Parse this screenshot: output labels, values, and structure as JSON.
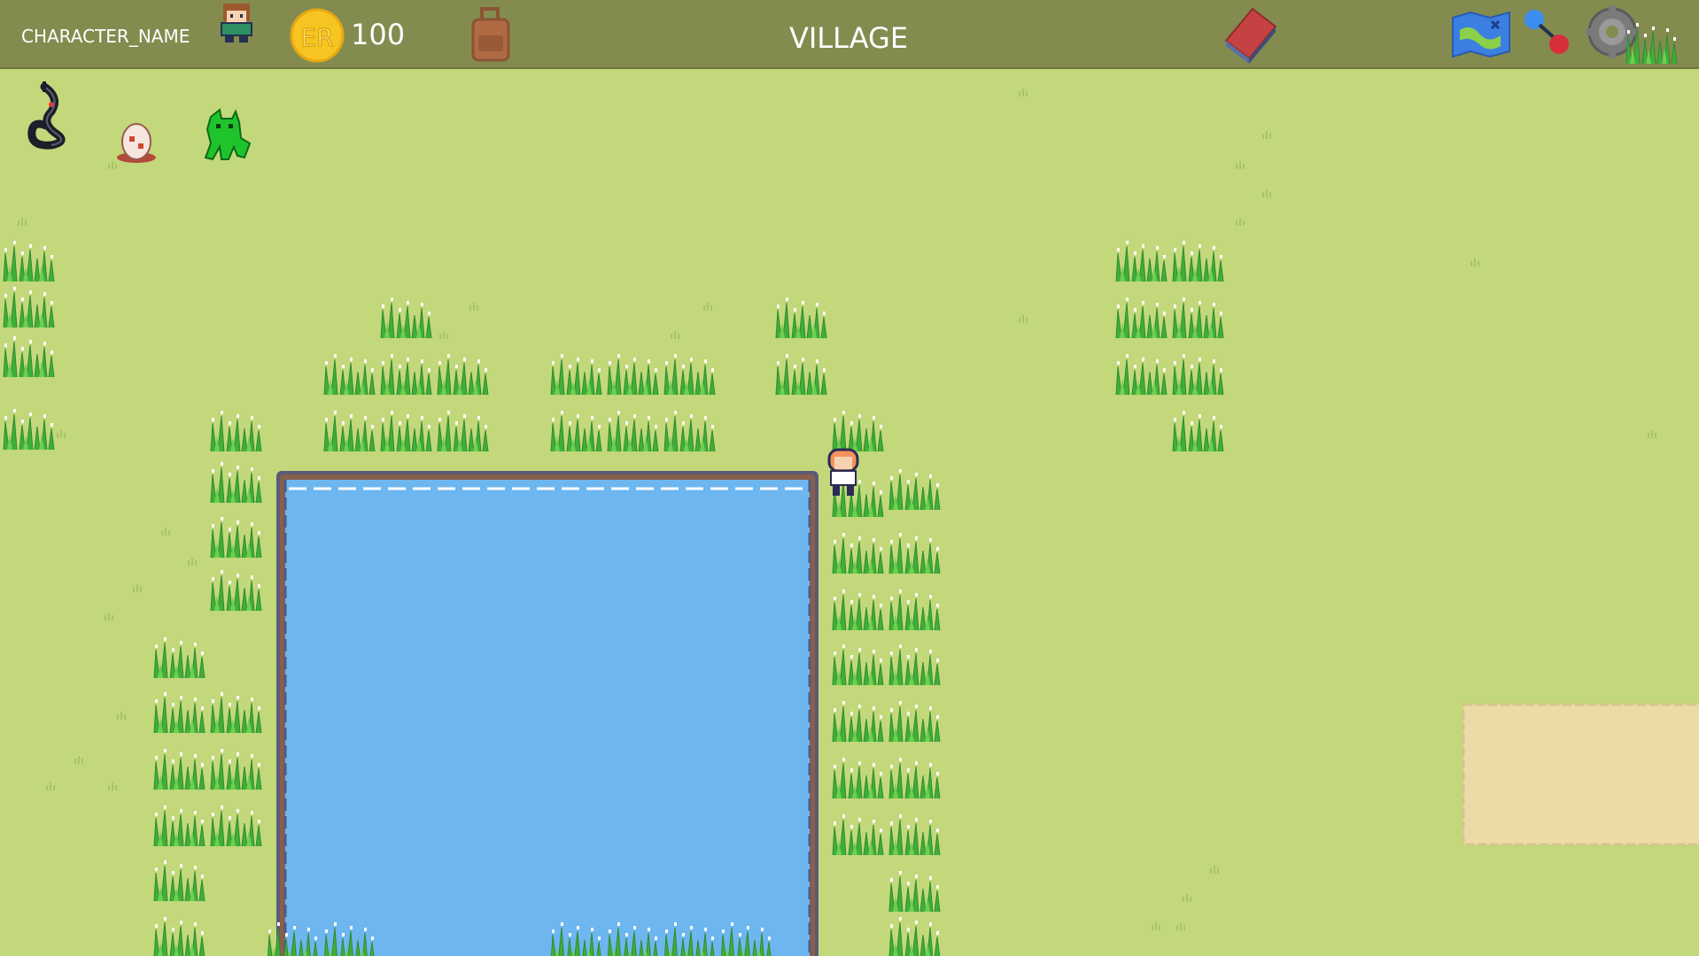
{
  "hud": {
    "character_name": "CHARACTER_NAME",
    "coin_symbol": "ER",
    "coin_count": "100",
    "location_title": "VILLAGE"
  },
  "icons": {
    "player_avatar": "player-avatar-icon",
    "coin": "coin-icon",
    "backpack": "backpack-icon",
    "journal": "journal-book-icon",
    "map": "map-icon",
    "connect": "connect-pin-icon",
    "settings": "gear-icon"
  },
  "party": [
    {
      "name": "party-creature-black-serpent"
    },
    {
      "name": "party-creature-egg"
    },
    {
      "name": "party-creature-green-dragon"
    }
  ],
  "colors": {
    "hud_bar": "#848b4f",
    "grass": "#c2d87a",
    "pond_water": "#6db6ef",
    "pond_border": "#5a5a78",
    "sand": "#ecdba6",
    "coin": "#f7c522",
    "tall_grass": "#3fae3a"
  }
}
